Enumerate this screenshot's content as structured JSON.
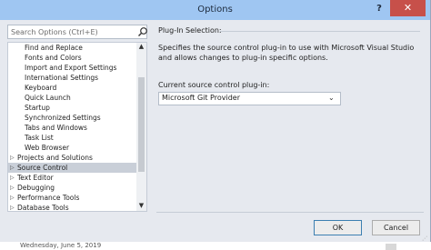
{
  "window": {
    "title": "Options",
    "help_label": "?",
    "close_label": "✕"
  },
  "background": {
    "bottom_text": "Wednesday, June 5, 2019"
  },
  "search": {
    "placeholder": "Search Options (Ctrl+E)",
    "value": ""
  },
  "tree": {
    "children": [
      {
        "label": "Find and Replace"
      },
      {
        "label": "Fonts and Colors"
      },
      {
        "label": "Import and Export Settings"
      },
      {
        "label": "International Settings"
      },
      {
        "label": "Keyboard"
      },
      {
        "label": "Quick Launch"
      },
      {
        "label": "Startup"
      },
      {
        "label": "Synchronized Settings"
      },
      {
        "label": "Tabs and Windows"
      },
      {
        "label": "Task List"
      },
      {
        "label": "Web Browser"
      }
    ],
    "top_items": [
      {
        "label": "Projects and Solutions",
        "expander": "▷"
      },
      {
        "label": "Source Control",
        "expander": "▷",
        "selected": true
      },
      {
        "label": "Text Editor",
        "expander": "▷"
      },
      {
        "label": "Debugging",
        "expander": "▷"
      },
      {
        "label": "Performance Tools",
        "expander": "▷"
      },
      {
        "label": "Database Tools",
        "expander": "▷"
      }
    ],
    "scroll_up": "▲",
    "scroll_down": "▼"
  },
  "panel": {
    "section_title": "Plug-In Selection:",
    "description": "Specifies the source control plug-in to use with Microsoft Visual Studio and allows changes to plug-in specific options.",
    "plugin_label": "Current source control plug-in:",
    "plugin_value": "Microsoft Git Provider",
    "plugin_chevron": "⌄"
  },
  "footer": {
    "ok_label": "OK",
    "cancel_label": "Cancel"
  },
  "colors": {
    "titlebar": "#9fc6f2",
    "close": "#c7504a",
    "selected_row": "#c9cfd8"
  }
}
